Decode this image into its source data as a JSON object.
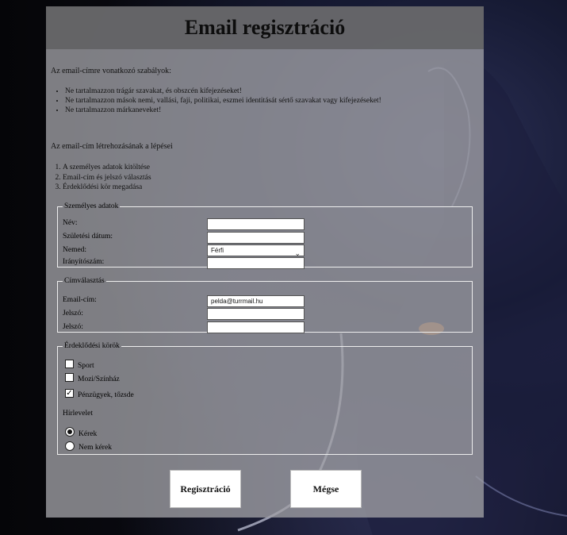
{
  "title": "Email regisztráció",
  "rules": {
    "intro": "Az email-címre vonatkozó szabályok:",
    "items": [
      "Ne tartalmazzon trágár szavakat, és obszcén kifejezéseket!",
      "Ne tartalmazzon mások nemi, vallási, faji, politikai, eszmei identitását sértő szavakat vagy kifejezéseket!",
      "Ne tartalmazzon márkaneveket!"
    ]
  },
  "steps": {
    "intro": "Az email-cím létrehozásának a lépései",
    "items": [
      "A személyes adatok kitöltése",
      "Email-cím és jelszó választás",
      "Érdeklődési kör megadása"
    ]
  },
  "personal": {
    "legend": "Személyes adatok",
    "name_label": "Név:",
    "name_value": "",
    "birth_label": "Születési dátum:",
    "birth_value": "",
    "gender_label": "Nemed:",
    "gender_value": "Férfi",
    "zip_label": "Irányítószám:",
    "zip_value": ""
  },
  "address": {
    "legend": "Címválasztás",
    "email_label": "Email-cím:",
    "email_value": "pelda@turrmail.hu",
    "password_label": "Jelszó:",
    "password_value": "",
    "password2_label": "Jelszó:",
    "password2_value": ""
  },
  "interests": {
    "legend": "Érdeklődési körök",
    "options": [
      {
        "label": "Sport",
        "checked": false
      },
      {
        "label": "Mozi/Színház",
        "checked": false
      },
      {
        "label": "Pénzügyek, tőzsde",
        "checked": true
      }
    ],
    "newsletter_label": "Hírlevelet",
    "newsletter_options": [
      {
        "label": "Kérek",
        "selected": true
      },
      {
        "label": "Nem kérek",
        "selected": false
      }
    ]
  },
  "buttons": {
    "register": "Regisztráció",
    "cancel": "Mégse"
  }
}
